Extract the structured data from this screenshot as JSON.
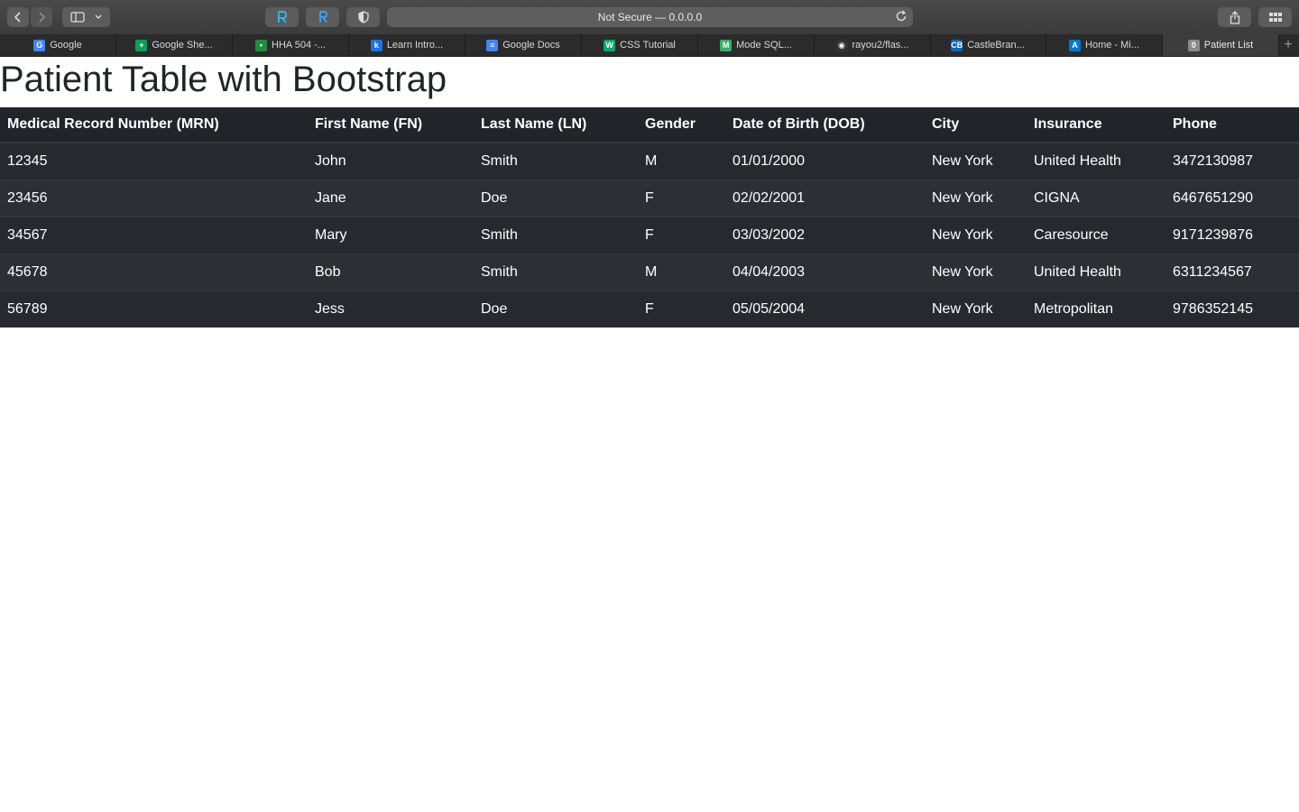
{
  "browser": {
    "address": "Not Secure — 0.0.0.0",
    "tabs": [
      {
        "label": "Google",
        "icon": "google-icon",
        "color": "#4285f4",
        "glyph": "G"
      },
      {
        "label": "Google She...",
        "icon": "sheets-icon",
        "color": "#0f9d58",
        "glyph": "+"
      },
      {
        "label": "HHA 504 -...",
        "icon": "classroom-icon",
        "color": "#1e8e3e",
        "glyph": "▪"
      },
      {
        "label": "Learn Intro...",
        "icon": "k-icon",
        "color": "#1a73e8",
        "glyph": "k"
      },
      {
        "label": "Google Docs",
        "icon": "docs-icon",
        "color": "#4285f4",
        "glyph": "≡"
      },
      {
        "label": "CSS Tutorial",
        "icon": "w3-icon",
        "color": "#04aa6d",
        "glyph": "W"
      },
      {
        "label": "Mode SQL...",
        "icon": "mode-icon",
        "color": "#37b067",
        "glyph": "M"
      },
      {
        "label": "rayou2/flas...",
        "icon": "github-icon",
        "color": "#333333",
        "glyph": "◉"
      },
      {
        "label": "CastleBran...",
        "icon": "castlebranch-icon",
        "color": "#0a66c2",
        "glyph": "CB"
      },
      {
        "label": "Home - Mi...",
        "icon": "azure-icon",
        "color": "#0078d4",
        "glyph": "A"
      },
      {
        "label": "Patient List",
        "icon": "patient-list-icon",
        "color": "#8a8a8a",
        "glyph": "0"
      }
    ]
  },
  "page": {
    "title": "Patient Table with Bootstrap",
    "table": {
      "headers": [
        "Medical Record Number (MRN)",
        "First Name (FN)",
        "Last Name (LN)",
        "Gender",
        "Date of Birth (DOB)",
        "City",
        "Insurance",
        "Phone"
      ],
      "rows": [
        [
          "12345",
          "John",
          "Smith",
          "M",
          "01/01/2000",
          "New York",
          "United Health",
          "3472130987"
        ],
        [
          "23456",
          "Jane",
          "Doe",
          "F",
          "02/02/2001",
          "New York",
          "CIGNA",
          "6467651290"
        ],
        [
          "34567",
          "Mary",
          "Smith",
          "F",
          "03/03/2002",
          "New York",
          "Caresource",
          "9171239876"
        ],
        [
          "45678",
          "Bob",
          "Smith",
          "M",
          "04/04/2003",
          "New York",
          "United Health",
          "6311234567"
        ],
        [
          "56789",
          "Jess",
          "Doe",
          "F",
          "05/05/2004",
          "New York",
          "Metropolitan",
          "9786352145"
        ]
      ]
    }
  }
}
